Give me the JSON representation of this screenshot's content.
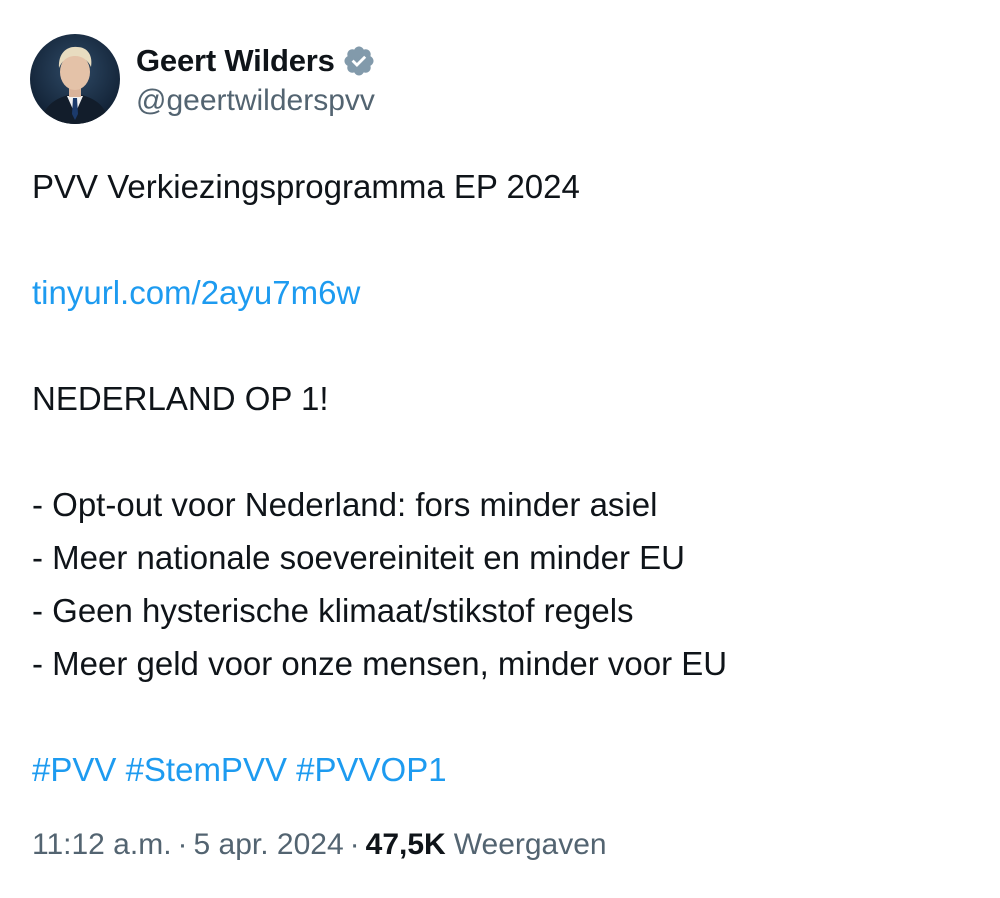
{
  "author": {
    "display_name": "Geert Wilders",
    "handle": "@geertwilderspvv",
    "verified_icon": "verified-badge-icon",
    "verified_color": "#829aab"
  },
  "tweet": {
    "title_line": "PVV Verkiezingsprogramma EP 2024",
    "link": "tinyurl.com/2ayu7m6w",
    "slogan": "NEDERLAND OP 1!",
    "bullets": [
      "- Opt-out voor Nederland: fors minder asiel",
      "- Meer nationale soevereiniteit en minder EU",
      "- Geen hysterische klimaat/stikstof regels",
      "- Meer geld voor onze mensen, minder voor EU"
    ],
    "hashtags": [
      "#PVV",
      "#StemPVV",
      "#PVVOP1"
    ]
  },
  "meta": {
    "time": "11:12 a.m.",
    "separator": "·",
    "date": "5 apr. 2024",
    "views_count": "47,5K",
    "views_label": "Weergaven"
  },
  "colors": {
    "link": "#1d9bf0",
    "text": "#0f1419",
    "secondary": "#536471"
  }
}
